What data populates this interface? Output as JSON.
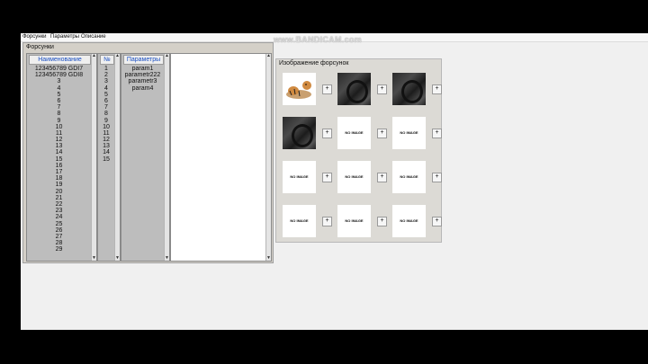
{
  "menu": [
    "Форсунки",
    "Параметры",
    "Описание"
  ],
  "watermark": "www.BANDICAM.com",
  "panel_title": "Форсунки",
  "names_column": {
    "header": "Наименование",
    "rows": [
      "123456789  GDI7",
      "123456789  GDI8",
      "3",
      "4",
      "5",
      "6",
      "7",
      "8",
      "9",
      "10",
      "11",
      "12",
      "13",
      "14",
      "15",
      "16",
      "17",
      "18",
      "19",
      "20",
      "21",
      "22",
      "23",
      "24",
      "25",
      "26",
      "27",
      "28",
      "29"
    ]
  },
  "num_column": {
    "header": "№",
    "rows": [
      "1",
      "2",
      "3",
      "4",
      "5",
      "6",
      "7",
      "8",
      "9",
      "10",
      "11",
      "12",
      "13",
      "14",
      "15"
    ]
  },
  "params_column": {
    "header": "Параметры",
    "rows": [
      "param1",
      "parametr222",
      "parametr3",
      "param4"
    ]
  },
  "image_panel": {
    "title": "Изображение форсунок",
    "no_image_text": "NO IMAGE",
    "plus_label": "+",
    "thumbs": [
      "tiger",
      "dark",
      "dark",
      "dark",
      "none",
      "none",
      "none",
      "none",
      "none",
      "none",
      "none",
      "none"
    ]
  },
  "scroll_arrows": {
    "up": "▲",
    "down": "▼"
  }
}
